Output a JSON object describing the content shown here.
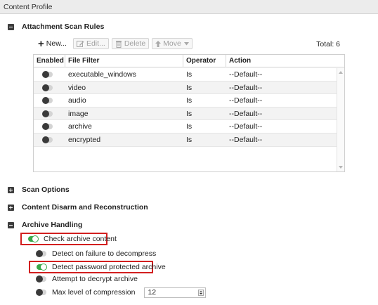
{
  "title": "Content Profile",
  "attachment_scan": {
    "heading": "Attachment Scan Rules",
    "toolbar": {
      "new": "New...",
      "edit": "Edit...",
      "delete": "Delete",
      "move": "Move"
    },
    "total": "Total: 6",
    "columns": [
      "Enabled",
      "File Filter",
      "Operator",
      "Action"
    ],
    "rows": [
      {
        "enabled": false,
        "filter": "executable_windows",
        "operator": "Is",
        "action": "--Default--"
      },
      {
        "enabled": false,
        "filter": "video",
        "operator": "Is",
        "action": "--Default--"
      },
      {
        "enabled": false,
        "filter": "audio",
        "operator": "Is",
        "action": "--Default--"
      },
      {
        "enabled": false,
        "filter": "image",
        "operator": "Is",
        "action": "--Default--"
      },
      {
        "enabled": false,
        "filter": "archive",
        "operator": "Is",
        "action": "--Default--"
      },
      {
        "enabled": false,
        "filter": "encrypted",
        "operator": "Is",
        "action": "--Default--"
      }
    ]
  },
  "sections": {
    "scan_options": "Scan Options",
    "cdr": "Content Disarm and Reconstruction",
    "archive": "Archive Handling"
  },
  "archive": {
    "check_archive": {
      "label": "Check archive content",
      "on": true
    },
    "detect_failure": {
      "label": "Detect on failure to decompress",
      "on": false
    },
    "detect_password": {
      "label": "Detect password protected archive",
      "on": true
    },
    "decrypt": {
      "label": "Attempt to decrypt archive",
      "on": false
    },
    "max_level": {
      "label": "Max level of compression",
      "on": false,
      "value": "12"
    }
  },
  "colors": {
    "toggle_on": "#3aa84a",
    "highlight": "#d21f1f"
  }
}
